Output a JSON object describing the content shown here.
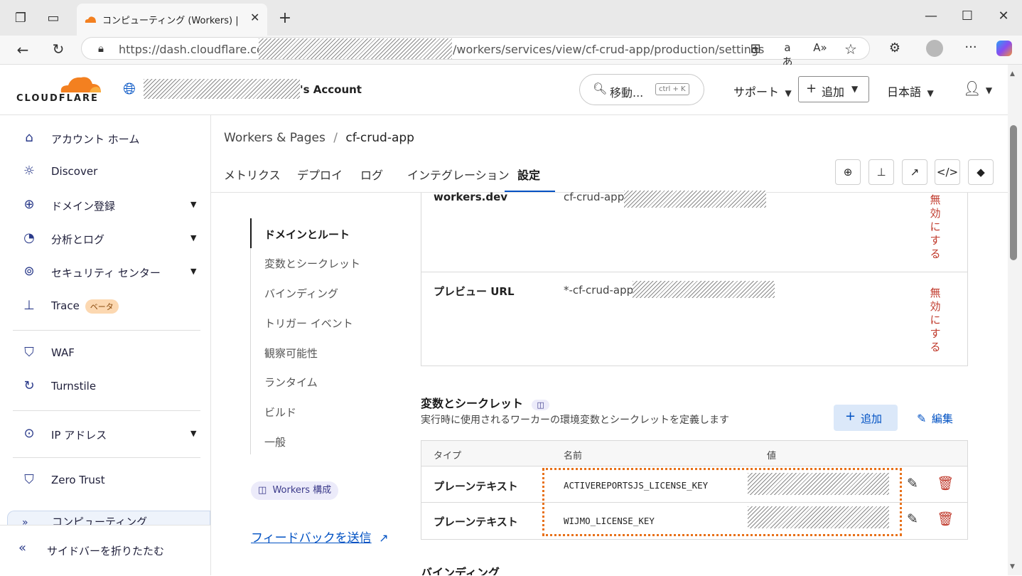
{
  "browser": {
    "tab_title": "コンピューティング (Workers) |",
    "url_prefix": "https://dash.cloudflare.com/",
    "url_suffix": "/workers/services/view/cf-crud-app/production/settings"
  },
  "header": {
    "logo_text": "CLOUDFLARE",
    "account_suffix": "'s Account",
    "search_label": "移動...",
    "search_shortcut": "ctrl + K",
    "support_label": "サポート",
    "add_label": "追加",
    "language_label": "日本語"
  },
  "sidebar": {
    "items": [
      {
        "label": "アカウント ホーム",
        "icon": "home-icon"
      },
      {
        "label": "Discover",
        "icon": "lightbulb-icon"
      },
      {
        "label": "ドメイン登録",
        "icon": "globe-icon"
      },
      {
        "label": "分析とログ",
        "icon": "pie-chart-icon"
      },
      {
        "label": "セキュリティ センター",
        "icon": "security-icon"
      },
      {
        "label": "Trace",
        "icon": "trace-icon",
        "badge": "ベータ"
      },
      {
        "label": "WAF",
        "icon": "waf-icon"
      },
      {
        "label": "Turnstile",
        "icon": "turnstile-icon"
      },
      {
        "label": "IP アドレス",
        "icon": "location-pin-icon"
      },
      {
        "label": "Zero Trust",
        "icon": "zero-trust-icon"
      },
      {
        "label": "コンピューティング",
        "icon": "compute-icon"
      }
    ],
    "collapse_label": "サイドバーを折りたたむ"
  },
  "main": {
    "breadcrumb": {
      "root": "Workers & Pages",
      "sep": "/",
      "current": "cf-crud-app"
    },
    "tabs": [
      "メトリクス",
      "デプロイ",
      "ログ",
      "インテグレーション",
      "設定"
    ],
    "active_tab": "設定",
    "subnav": [
      "ドメインとルート",
      "変数とシークレット",
      "バインディング",
      "トリガー イベント",
      "観察可能性",
      "ランタイム",
      "ビルド",
      "一般"
    ],
    "workers_config_link": "Workers 構成",
    "feedback_link": "フィードバックを送信",
    "domains": [
      {
        "label": "workers.dev",
        "value": "cf-crud-app.",
        "action": "無効にする"
      },
      {
        "label": "プレビュー URL",
        "value": "*-cf-crud-app.",
        "action": "無効にする"
      }
    ],
    "variables": {
      "title": "変数とシークレット",
      "description": "実行時に使用されるワーカーの環境変数とシークレットを定義します",
      "add_button": "追加",
      "edit_button": "編集",
      "columns": [
        "タイプ",
        "名前",
        "値"
      ],
      "rows": [
        {
          "type": "プレーンテキスト",
          "name": "ACTIVEREPORTSJS_LICENSE_KEY"
        },
        {
          "type": "プレーンテキスト",
          "name": "WIJMO_LICENSE_KEY"
        }
      ]
    },
    "next_section_title": "バインディング"
  },
  "colors": {
    "accent": "#0051c3",
    "highlight": "#e8711a",
    "danger": "#c0392b",
    "brand_orange": "#f38020"
  }
}
